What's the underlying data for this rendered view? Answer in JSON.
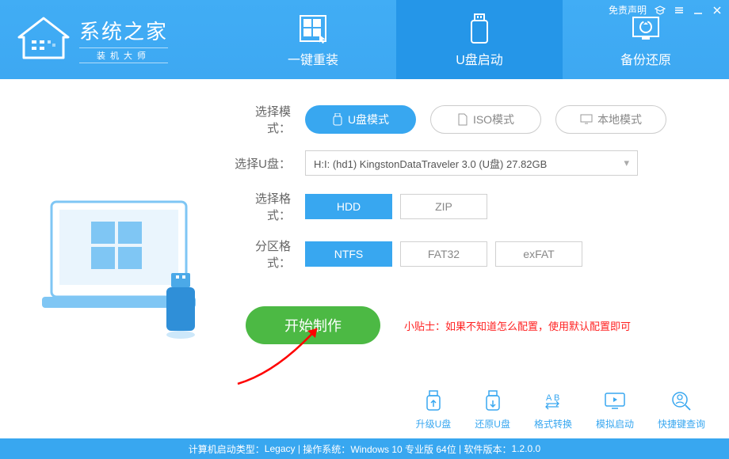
{
  "header": {
    "logo_title": "系统之家",
    "logo_sub": "装机大师",
    "disclaimer": "免责声明"
  },
  "tabs": [
    {
      "label": "一键重装"
    },
    {
      "label": "U盘启动"
    },
    {
      "label": "备份还原"
    }
  ],
  "form": {
    "mode_label": "选择模式：",
    "mode_usb": "U盘模式",
    "mode_iso": "ISO模式",
    "mode_local": "本地模式",
    "usb_label": "选择U盘：",
    "usb_value": "H:I: (hd1) KingstonDataTraveler 3.0 (U盘) 27.82GB",
    "fmt_label": "选择格式：",
    "fmt_hdd": "HDD",
    "fmt_zip": "ZIP",
    "part_label": "分区格式：",
    "part_ntfs": "NTFS",
    "part_fat32": "FAT32",
    "part_exfat": "exFAT",
    "start": "开始制作",
    "tip": "小贴士：如果不知道怎么配置，使用默认配置即可"
  },
  "bottom": {
    "upgrade": "升级U盘",
    "restore": "还原U盘",
    "convert": "格式转换",
    "simboot": "模拟启动",
    "shortcut": "快捷键查询"
  },
  "status": {
    "boot_type_label": "计算机启动类型：",
    "boot_type": "Legacy",
    "os_label": "操作系统：",
    "os": "Windows 10 专业版 64位",
    "ver_label": "软件版本：",
    "ver": "1.2.0.0"
  }
}
